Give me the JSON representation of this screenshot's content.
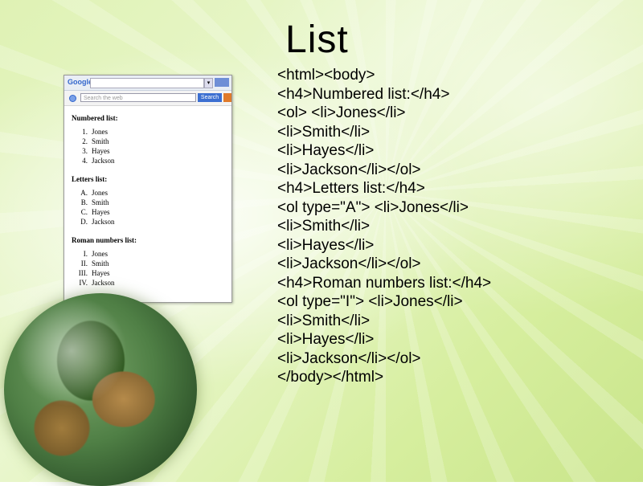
{
  "slide": {
    "title": "List"
  },
  "code_lines": [
    "<html><body>",
    "<h4>Numbered list:</h4>",
    "<ol> <li>Jones</li>",
    "<li>Smith</li>",
    "<li>Hayes</li>",
    "<li>Jackson</li></ol>",
    "<h4>Letters list:</h4>",
    "<ol type=\"A\"> <li>Jones</li>",
    "<li>Smith</li>",
    "<li>Hayes</li>",
    "<li>Jackson</li></ol>",
    "<h4>Roman numbers list:</h4>",
    "<ol type=\"I\"> <li>Jones</li>",
    "<li>Smith</li>",
    "<li>Hayes</li>",
    "<li>Jackson</li></ol>",
    "</body></html>"
  ],
  "browser": {
    "logo": "Google",
    "search_placeholder": "Search the web",
    "search_button": "Search",
    "lists": [
      {
        "heading": "Numbered list:",
        "markers": [
          "1.",
          "2.",
          "3.",
          "4."
        ],
        "items": [
          "Jones",
          "Smith",
          "Hayes",
          "Jackson"
        ]
      },
      {
        "heading": "Letters list:",
        "markers": [
          "A.",
          "B.",
          "C.",
          "D."
        ],
        "items": [
          "Jones",
          "Smith",
          "Hayes",
          "Jackson"
        ]
      },
      {
        "heading": "Roman numbers list:",
        "markers": [
          "I.",
          "II.",
          "III.",
          "IV."
        ],
        "items": [
          "Jones",
          "Smith",
          "Hayes",
          "Jackson"
        ]
      }
    ]
  }
}
